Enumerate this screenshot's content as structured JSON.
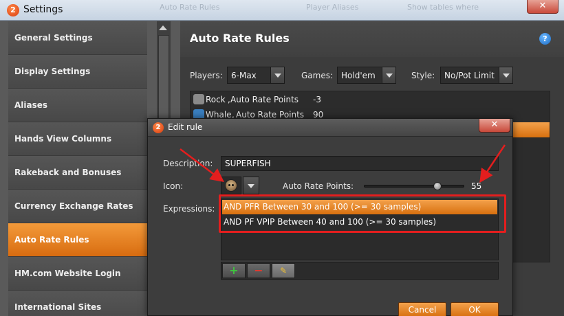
{
  "window": {
    "title": "Settings",
    "ghost_items": [
      "Auto Rate Rules",
      "Player Aliases",
      "Show tables where"
    ],
    "close_glyph": "✕"
  },
  "sidebar": {
    "items": [
      {
        "label": "General Settings",
        "active": false
      },
      {
        "label": "Display Settings",
        "active": false
      },
      {
        "label": "Aliases",
        "active": false
      },
      {
        "label": "Hands View Columns",
        "active": false
      },
      {
        "label": "Rakeback and Bonuses",
        "active": false
      },
      {
        "label": "Currency Exchange Rates",
        "active": false
      },
      {
        "label": "Auto Rate Rules",
        "active": true
      },
      {
        "label": "HM.com Website Login",
        "active": false
      },
      {
        "label": "International Sites",
        "active": false
      }
    ]
  },
  "main": {
    "title": "Auto Rate Rules",
    "help_glyph": "?",
    "filters": {
      "players_label": "Players:",
      "players_value": "6-Max",
      "games_label": "Games:",
      "games_value": "Hold'em",
      "style_label": "Style:",
      "style_value": "No/Pot Limit"
    },
    "rules": [
      {
        "name": "Rock",
        "points_label": "Auto Rate Points",
        "points": "-3",
        "icon": "rock-icon",
        "color": "#8a8a8a"
      },
      {
        "name": "Whale",
        "points_label": "Auto Rate Points",
        "points": "90",
        "icon": "whale-icon",
        "color": "#3a7fc0"
      }
    ]
  },
  "dialog": {
    "title": "Edit rule",
    "close_glyph": "✕",
    "description_label": "Description:",
    "description_value": "SUPERFISH",
    "icon_label": "Icon:",
    "icon_name": "monkey-icon",
    "points_label": "Auto Rate Points:",
    "points_value": "55",
    "slider_fraction": 0.75,
    "expressions_label": "Expressions:",
    "expressions": [
      {
        "text": "AND PFR Between 30 and 100 (>= 30 samples)",
        "selected": true
      },
      {
        "text": "AND PF VPIP Between 40 and 100 (>= 30 samples)",
        "selected": false
      }
    ],
    "toolbar": {
      "add": "+",
      "remove": "−",
      "edit": "✎"
    },
    "cancel_label": "Cancel",
    "ok_label": "OK"
  },
  "colors": {
    "accent": "#f08a24",
    "annotation": "#e41e1e",
    "panel": "#3c3c3c"
  }
}
